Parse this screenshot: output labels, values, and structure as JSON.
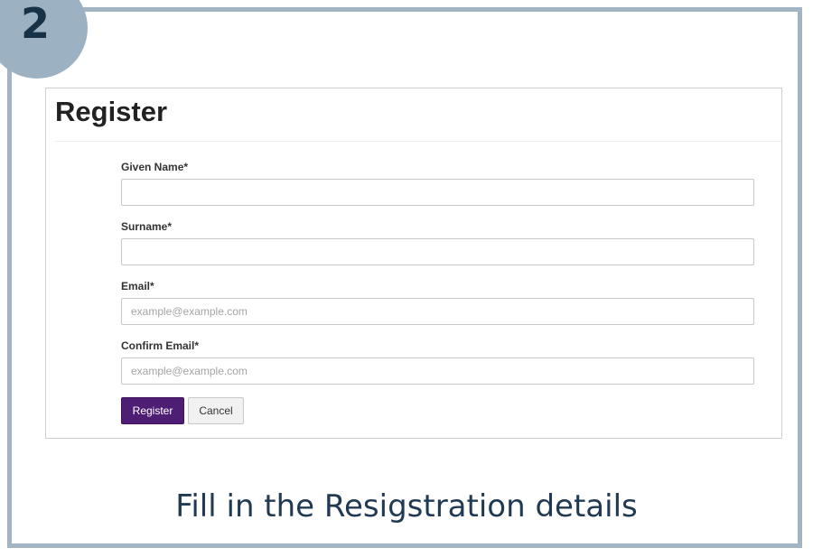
{
  "step": {
    "number": "2"
  },
  "form": {
    "title": "Register",
    "fields": [
      {
        "label": "Given Name*",
        "value": "",
        "placeholder": ""
      },
      {
        "label": "Surname*",
        "value": "",
        "placeholder": ""
      },
      {
        "label": "Email*",
        "value": "",
        "placeholder": "example@example.com"
      },
      {
        "label": "Confirm Email*",
        "value": "",
        "placeholder": "example@example.com"
      }
    ],
    "register_label": "Register",
    "cancel_label": "Cancel"
  },
  "caption": "Fill in the Resigstration details",
  "colors": {
    "primary_button": "#4e1e74",
    "frame": "#a3b5c3",
    "caption_text": "#1f3a52"
  }
}
